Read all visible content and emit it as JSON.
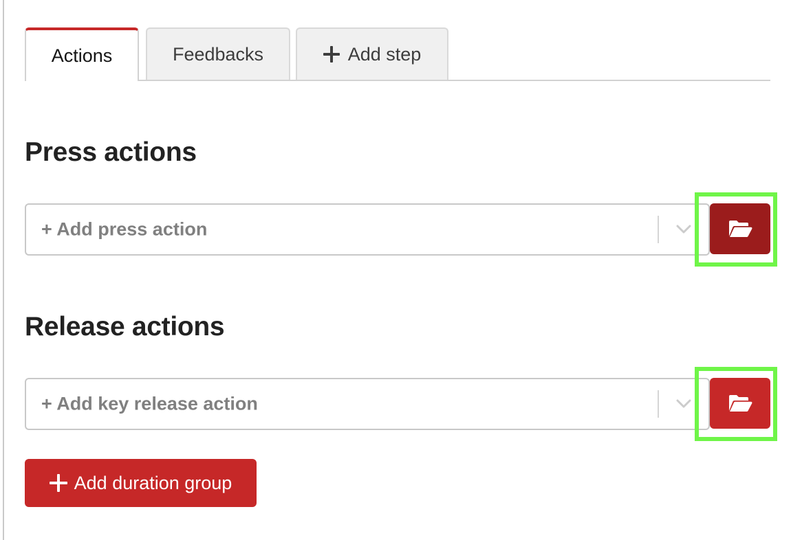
{
  "tabs": {
    "items": [
      {
        "label": "Actions",
        "active": true
      },
      {
        "label": "Feedbacks",
        "active": false
      },
      {
        "label": "Add step",
        "active": false,
        "icon": "plus-icon"
      }
    ]
  },
  "press_section": {
    "title": "Press actions",
    "select_placeholder": "+ Add press action",
    "dropdown_icon": "chevron-down-icon",
    "browse_button_icon": "folder-open-icon",
    "browse_button_color": "#9b1c1c",
    "highlighted": true
  },
  "release_section": {
    "title": "Release actions",
    "select_placeholder": "+ Add key release action",
    "dropdown_icon": "chevron-down-icon",
    "browse_button_icon": "folder-open-icon",
    "browse_button_color": "#c62828",
    "highlighted": true
  },
  "footer": {
    "add_duration_group_label": "Add duration group",
    "icon": "plus-icon"
  },
  "colors": {
    "accent": "#c62828",
    "accent_dark": "#9b1c1c",
    "highlight": "#6ff548",
    "placeholder_text": "#808080"
  }
}
